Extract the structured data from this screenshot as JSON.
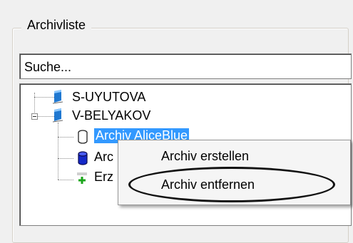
{
  "groupbox": {
    "legend": "Archivliste"
  },
  "search": {
    "value": "Suche..."
  },
  "tree": {
    "nodes": [
      {
        "label": "S-UYUTOVA",
        "icon": "server-icon"
      },
      {
        "label": "V-BELYAKOV",
        "icon": "server-icon"
      }
    ],
    "children": [
      {
        "label": "Archiv AliceBlue",
        "icon": "archive-empty-icon",
        "selected": true
      },
      {
        "label": "Arc",
        "icon": "archive-filled-icon"
      },
      {
        "label": "Erz",
        "icon": "add-archive-icon"
      }
    ]
  },
  "context_menu": {
    "items": [
      {
        "label": "Archiv erstellen"
      },
      {
        "label": "Archiv entfernen",
        "circled": true
      }
    ]
  },
  "colors": {
    "selection": "#3399ff",
    "server_icon": "#1f78d1",
    "archive_filled": "#1428c8",
    "add_icon": "#1aa51a"
  }
}
